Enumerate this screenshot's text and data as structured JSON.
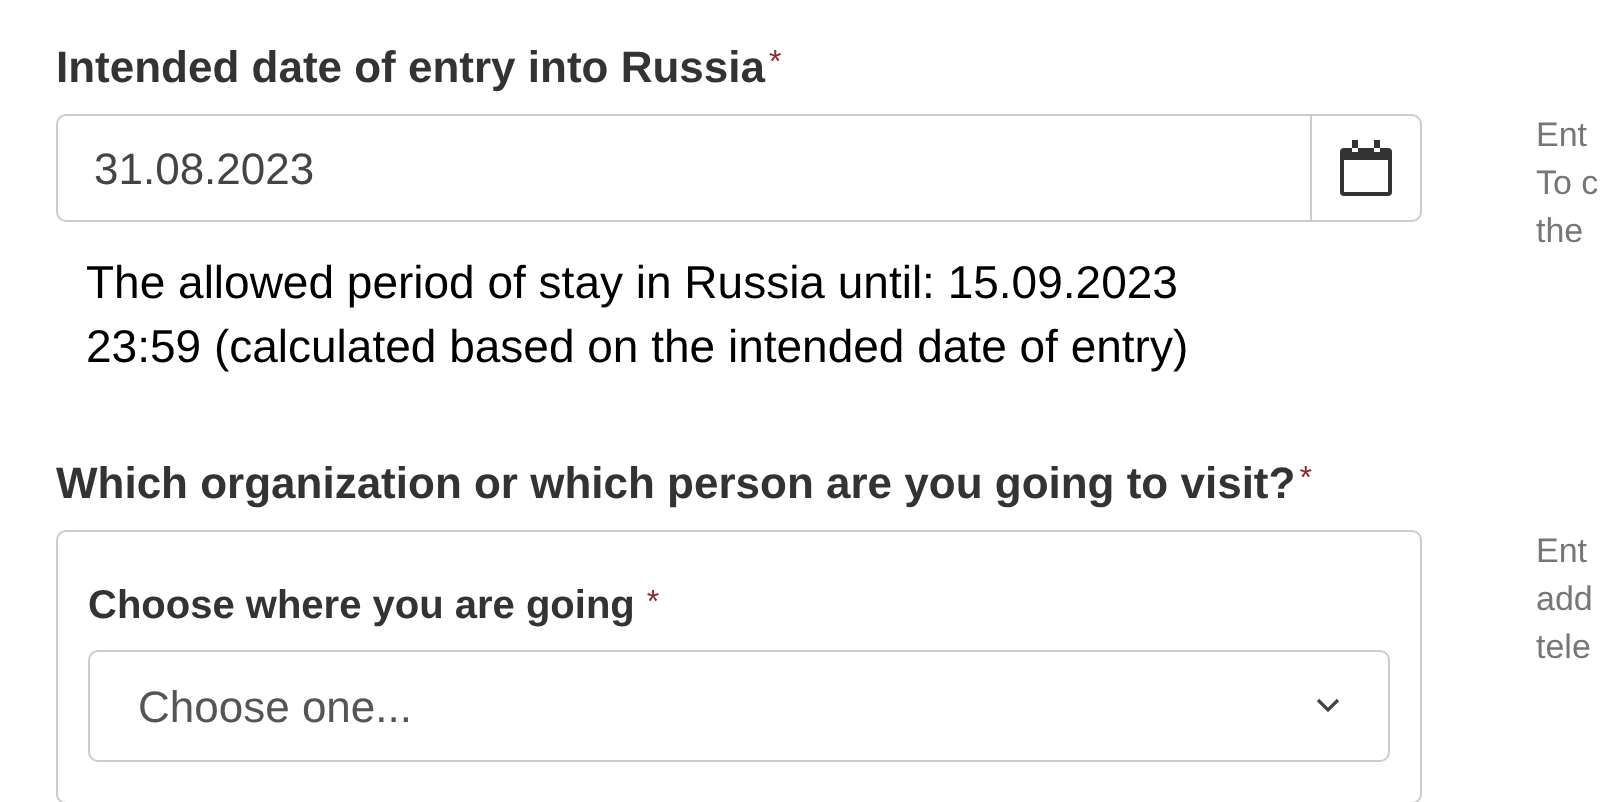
{
  "entry_date": {
    "label": "Intended date of entry into Russia",
    "required_mark": "*",
    "value": "31.08.2023",
    "note": [
      "The allowed period of stay in Russia until: 15.09.2023",
      "23:59 (calculated based on the intended date of entry)"
    ],
    "hint": [
      "Ent",
      "To c",
      "the"
    ]
  },
  "visit": {
    "label": "Which organization or which person are you going to visit?",
    "required_mark": "*",
    "hint": [
      "Ent",
      "add",
      "tele"
    ],
    "destination": {
      "label": "Choose where you are going",
      "required_mark": "*",
      "placeholder": "Choose one..."
    }
  }
}
